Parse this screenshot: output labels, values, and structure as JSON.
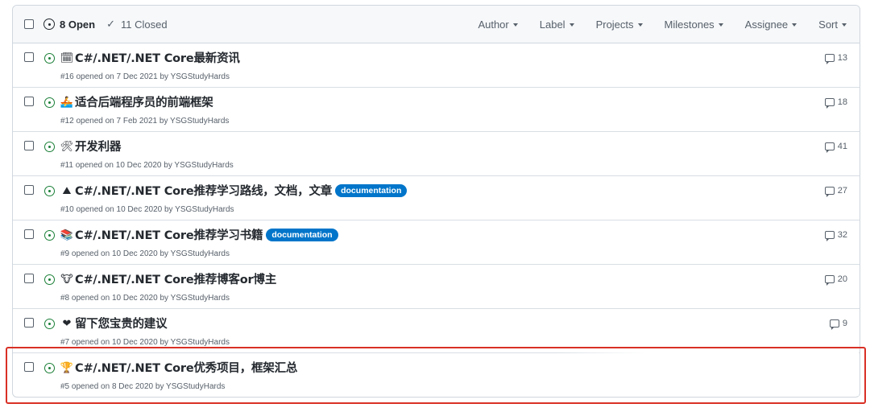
{
  "header": {
    "open_count": "8 Open",
    "closed_count": "11 Closed",
    "filters": [
      "Author",
      "Label",
      "Projects",
      "Milestones",
      "Assignee",
      "Sort"
    ]
  },
  "colors": {
    "open_green": "#1a7f37",
    "label_documentation": "#0075ca",
    "highlight_red": "#d93025"
  },
  "issues": [
    {
      "emoji": "🗓",
      "emoji_name": "calendar-icon",
      "title": "C#/.NET/.NET Core最新资讯",
      "label": "",
      "meta": "#16 opened on 7 Dec 2021 by YSGStudyHards",
      "comments": "13"
    },
    {
      "emoji": "🚣",
      "emoji_name": "rowboat-icon",
      "title": "适合后端程序员的前端框架",
      "label": "",
      "meta": "#12 opened on 7 Feb 2021 by YSGStudyHards",
      "comments": "18"
    },
    {
      "emoji": "🛠",
      "emoji_name": "tools-icon",
      "title": "开发利器",
      "label": "",
      "meta": "#11 opened on 10 Dec 2020 by YSGStudyHards",
      "comments": "41"
    },
    {
      "emoji": "⛰",
      "emoji_name": "mountain-icon",
      "title": "C#/.NET/.NET Core推荐学习路线，文档，文章",
      "label": "documentation",
      "meta": "#10 opened on 10 Dec 2020 by YSGStudyHards",
      "comments": "27"
    },
    {
      "emoji": "📚",
      "emoji_name": "books-icon",
      "title": "C#/.NET/.NET Core推荐学习书籍",
      "label": "documentation",
      "meta": "#9 opened on 10 Dec 2020 by YSGStudyHards",
      "comments": "32"
    },
    {
      "emoji": "🐮",
      "emoji_name": "cow-face-icon",
      "title": "C#/.NET/.NET Core推荐博客or博主",
      "label": "",
      "meta": "#8 opened on 10 Dec 2020 by YSGStudyHards",
      "comments": "20"
    },
    {
      "emoji": "❤",
      "emoji_name": "heart-icon",
      "title": "留下您宝贵的建议",
      "label": "",
      "meta": "#7 opened on 10 Dec 2020 by YSGStudyHards",
      "comments": "9"
    },
    {
      "emoji": "🏆",
      "emoji_name": "trophy-icon",
      "title": "C#/.NET/.NET Core优秀项目，框架汇总",
      "label": "",
      "meta": "#5 opened on 8 Dec 2020 by YSGStudyHards",
      "comments": ""
    }
  ]
}
